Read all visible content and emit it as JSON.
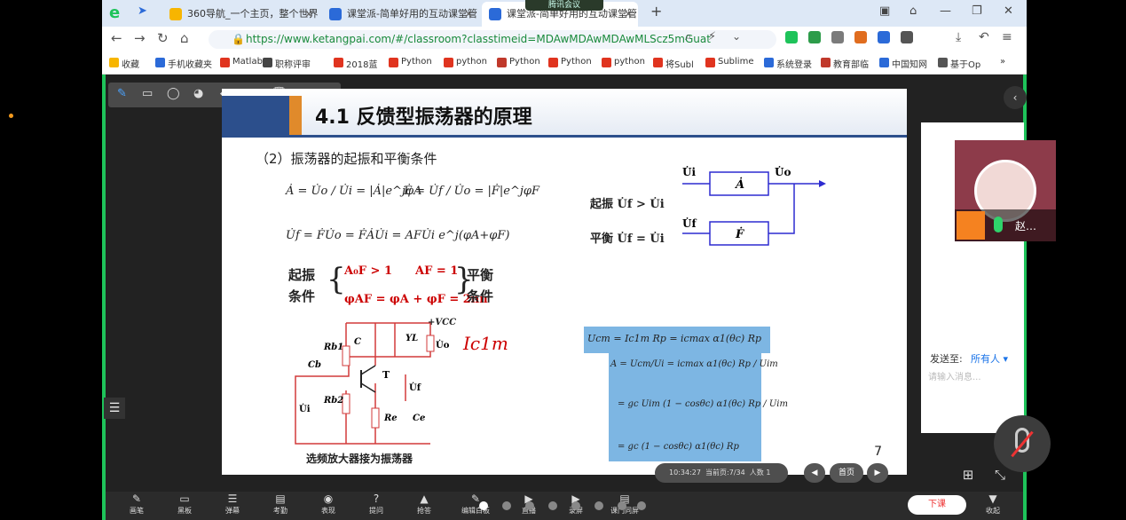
{
  "browser": {
    "tabs": [
      {
        "label": "360导航_一个主页，整个世界",
        "color": "#f7b500"
      },
      {
        "label": "课堂派-简单好用的互动课堂管",
        "color": "#2b6ad8"
      },
      {
        "label": "课堂派-简单好用的互动课堂管",
        "color": "#2b6ad8"
      }
    ],
    "new_tab": "+",
    "url": "https://www.ketangpai.com/#/classroom?classtimeid=MDAwMDAwMDAwMLScz5mGuat",
    "meeting_banner": "腾讯会议",
    "bookmarks_label": "收藏",
    "bookmarks": [
      "手机收藏夹",
      "Matlab",
      "职称评审",
      "2018蓝",
      "Python",
      "python",
      "Python",
      "Python",
      "python",
      "将Subl",
      "Sublime",
      "系统登录",
      "教育部临",
      "中国知网",
      "基于Op"
    ]
  },
  "drawbar": {
    "close_label": "关闭"
  },
  "slide": {
    "title": "4.1 反馈型振荡器的原理",
    "subtitle": "（2）振荡器的起振和平衡条件",
    "eq_A": "Ȧ = U̇o / U̇i = |Ȧ|e^jφA",
    "eq_F": "Ḟ = U̇f / U̇o = |Ḟ|e^jφF",
    "eq_Uf": "U̇f = ḞU̇o = ḞȦU̇i = AFU̇i e^j(φA+φF)",
    "startup_label": "起振",
    "startup_cond": "U̇f > U̇i",
    "balance_label": "平衡",
    "balance_cond": "U̇f = U̇i",
    "block_A": "Ȧ",
    "block_F": "Ḟ",
    "node_ui": "U̇i",
    "node_uo": "U̇o",
    "node_uf": "U̇f",
    "cond_left": "起振条件",
    "cond_right": "平衡条件",
    "cond_ineq": "A₀F > 1",
    "cond_eq": "AF = 1",
    "cond_phase": "φAF = φA + φF = 2nπ",
    "circuit_vcc": "+VCC",
    "circuit_parts": [
      "Rb1",
      "Rb2",
      "Cb",
      "C",
      "YL",
      "T",
      "Re",
      "Ce",
      "U̇o",
      "U̇f",
      "U̇i"
    ],
    "handwriting": "Ic1m",
    "blue_eq1": "Ucm = Ic1m Rp = icmax α1(θc) Rp",
    "blue_eq2": "A = Ucm/Ui = icmax α1(θc) Rp / Uim",
    "blue_eq3": "= gc Uim (1 − cosθc) α1(θc) Rp / Uim",
    "blue_eq4": "= gc (1 − cosθc) α1(θc) Rp",
    "caption": "选频放大器接为振荡器",
    "page_number": "7"
  },
  "panel": {
    "send_to": "发送至:",
    "send_target": "所有人",
    "input_placeholder": "请输入消息...",
    "participant_name": "赵…"
  },
  "controls": {
    "time": "10:34:27",
    "page_info": "当前页:7/34",
    "people": "人数 1",
    "prev": "◀",
    "home": "首页",
    "next": "▶"
  },
  "bottom": {
    "tools": [
      {
        "glyph": "✎",
        "label": "画笔"
      },
      {
        "glyph": "▭",
        "label": "黑板"
      },
      {
        "glyph": "☰",
        "label": "弹幕"
      },
      {
        "glyph": "▤",
        "label": "考勤"
      },
      {
        "glyph": "◉",
        "label": "表现"
      },
      {
        "glyph": "?",
        "label": "提问"
      },
      {
        "glyph": "▲",
        "label": "抢答"
      },
      {
        "glyph": "✎",
        "label": "编辑白板"
      },
      {
        "glyph": "▶",
        "label": "直播"
      },
      {
        "glyph": "▶",
        "label": "录屏"
      },
      {
        "glyph": "▤",
        "label": "课门同屏"
      }
    ],
    "end_class": "下课",
    "collapse_label": "收起"
  }
}
